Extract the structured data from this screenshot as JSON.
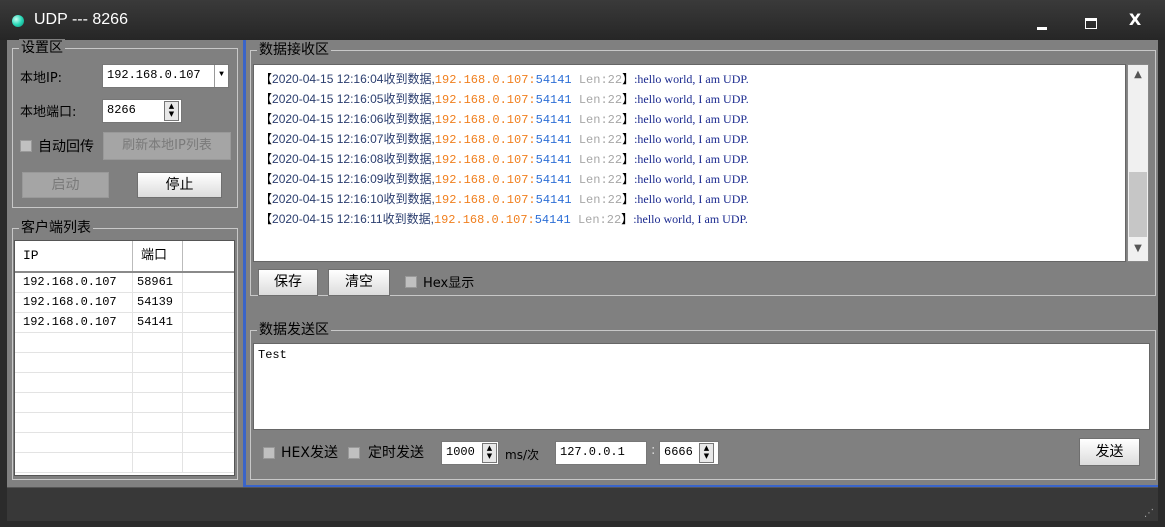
{
  "window": {
    "title": "UDP --- 8266",
    "min_glyph": "",
    "max_glyph": "",
    "close_glyph": "X"
  },
  "settings": {
    "group_title": "设置区",
    "local_ip_label": "本地IP:",
    "local_ip_value": "192.168.0.107",
    "local_port_label": "本地端口:",
    "local_port_value": "8266",
    "auto_reply_label": "自动回传",
    "refresh_ip_button": "刷新本地IP列表",
    "start_button": "启动",
    "stop_button": "停止"
  },
  "clients": {
    "group_title": "客户端列表",
    "columns": [
      "IP",
      "端口"
    ],
    "rows": [
      {
        "ip": "192.168.0.107",
        "port": "58961"
      },
      {
        "ip": "192.168.0.107",
        "port": "54139"
      },
      {
        "ip": "192.168.0.107",
        "port": "54141"
      }
    ]
  },
  "receive": {
    "group_title": "数据接收区",
    "lines": [
      {
        "open": "【",
        "time": "2020-04-15 12:16:04",
        "recv": "收到数据,",
        "ip": "192.168.0.107:",
        "port": "54141",
        "len": " Len:22",
        "close": "】",
        "msg": ":hello world, I am UDP."
      },
      {
        "open": "【",
        "time": "2020-04-15 12:16:05",
        "recv": "收到数据,",
        "ip": "192.168.0.107:",
        "port": "54141",
        "len": " Len:22",
        "close": "】",
        "msg": ":hello world, I am UDP."
      },
      {
        "open": "【",
        "time": "2020-04-15 12:16:06",
        "recv": "收到数据,",
        "ip": "192.168.0.107:",
        "port": "54141",
        "len": " Len:22",
        "close": "】",
        "msg": ":hello world, I am UDP."
      },
      {
        "open": "【",
        "time": "2020-04-15 12:16:07",
        "recv": "收到数据,",
        "ip": "192.168.0.107:",
        "port": "54141",
        "len": " Len:22",
        "close": "】",
        "msg": ":hello world, I am UDP."
      },
      {
        "open": "【",
        "time": "2020-04-15 12:16:08",
        "recv": "收到数据,",
        "ip": "192.168.0.107:",
        "port": "54141",
        "len": " Len:22",
        "close": "】",
        "msg": ":hello world, I am UDP."
      },
      {
        "open": "【",
        "time": "2020-04-15 12:16:09",
        "recv": "收到数据,",
        "ip": "192.168.0.107:",
        "port": "54141",
        "len": " Len:22",
        "close": "】",
        "msg": ":hello world, I am UDP."
      },
      {
        "open": "【",
        "time": "2020-04-15 12:16:10",
        "recv": "收到数据,",
        "ip": "192.168.0.107:",
        "port": "54141",
        "len": " Len:22",
        "close": "】",
        "msg": ":hello world, I am UDP."
      },
      {
        "open": "【",
        "time": "2020-04-15 12:16:11",
        "recv": "收到数据,",
        "ip": "192.168.0.107:",
        "port": "54141",
        "len": " Len:22",
        "close": "】",
        "msg": ":hello world, I am UDP."
      }
    ],
    "save_button": "保存",
    "clear_button": "清空",
    "hex_display_label": "Hex显示"
  },
  "send": {
    "group_title": "数据发送区",
    "content": "Test",
    "hex_send_label": "HEX发送",
    "timed_send_label": "定时发送",
    "interval_value": "1000",
    "interval_unit": "ms/次",
    "target_ip": "127.0.0.1",
    "colon": ":",
    "target_port": "6666",
    "send_button": "发送"
  },
  "colors": {
    "panel": "#808080",
    "accent_blue": "#3a64c8",
    "timestamp": "#2a3d6e",
    "ip": "#f07f1e",
    "port": "#2d6fd6",
    "len": "#a7a7a7",
    "message": "#1b2a8f"
  }
}
